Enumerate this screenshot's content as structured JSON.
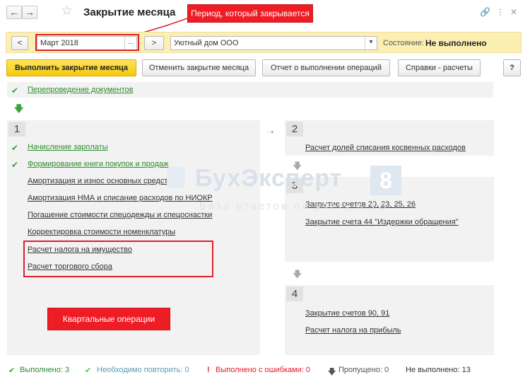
{
  "header": {
    "back_icon": "arrow-left-icon",
    "forward_icon": "arrow-right-icon",
    "star_icon": "star-icon",
    "title": "Закрытие месяца",
    "menu_icons": [
      "link-icon",
      "more-icon",
      "close-icon"
    ]
  },
  "annotations": {
    "period_note": "Период, который закрывается",
    "quarterly_note": "Квартальные операции"
  },
  "period_bar": {
    "prev_label": "<",
    "period_value": "Март 2018",
    "period_picker": "...",
    "next_label": ">",
    "organization_value": "Уютный дом ООО",
    "state_label": "Состояние:",
    "state_value": "Не выполнено"
  },
  "toolbar": {
    "run_label": "Выполнить закрытие месяца",
    "cancel_label": "Отменить закрытие месяца",
    "report_label": "Отчет о выполнении операций",
    "reference_label": "Справки - расчеты",
    "help_label": "?"
  },
  "operations": {
    "repost": "Перепроведение документов",
    "stage1": {
      "number": "1",
      "items": [
        "Начисление зарплаты",
        "Формирование книги покупок и продаж",
        "Амортизация и износ основных средств",
        "Амортизация НМА и списание расходов по НИОКР",
        "Погашение стоимости спецодежды и спецоснастки",
        "Корректировка стоимости номенклатуры",
        "Расчет налога на имущество",
        "Расчет торгового сбора"
      ]
    },
    "stage2": {
      "number": "2",
      "items": [
        "Расчет долей списания косвенных расходов"
      ]
    },
    "stage3": {
      "number": "3",
      "items": [
        "Закрытие счетов 20, 23, 25, 26",
        "Закрытие счета 44 \"Издержки обращения\""
      ]
    },
    "stage4": {
      "number": "4",
      "items": [
        "Закрытие счетов 90, 91",
        "Расчет налога на прибыль"
      ]
    }
  },
  "watermark": {
    "brand": "БухЭксперт",
    "digit": "8",
    "tagline": "База ответов по учету в 1С"
  },
  "status": {
    "done": "Выполнено: 3",
    "repeat": "Необходимо повторить: 0",
    "errors": "Выполнено с ошибками: 0",
    "skipped": "Пропущено: 0",
    "not_done": "Не выполнено: 13"
  },
  "colors": {
    "done_green": "#2e8b2e",
    "accent_yellow": "#f5c90d",
    "annotation_red": "#ee1c24"
  }
}
